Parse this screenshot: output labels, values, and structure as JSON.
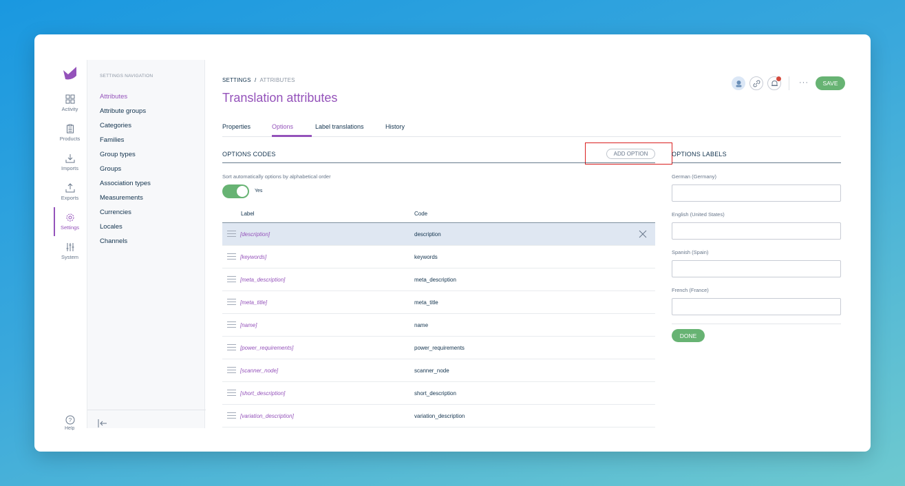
{
  "colors": {
    "accent": "#9452ba",
    "success": "#67b373",
    "text": "#11324d",
    "muted": "#67768a",
    "highlight": "#d91e1e"
  },
  "mainnav": {
    "items": [
      {
        "label": "Activity",
        "icon": "activity-icon"
      },
      {
        "label": "Products",
        "icon": "products-icon"
      },
      {
        "label": "Imports",
        "icon": "imports-icon"
      },
      {
        "label": "Exports",
        "icon": "exports-icon"
      },
      {
        "label": "Settings",
        "icon": "gear-icon",
        "active": true
      },
      {
        "label": "System",
        "icon": "sliders-icon"
      }
    ],
    "help_label": "Help"
  },
  "settings_nav": {
    "title": "SETTINGS NAVIGATION",
    "items": [
      "Attributes",
      "Attribute groups",
      "Categories",
      "Families",
      "Group types",
      "Groups",
      "Association types",
      "Measurements",
      "Currencies",
      "Locales",
      "Channels"
    ],
    "active": "Attributes"
  },
  "breadcrumb": {
    "root": "SETTINGS",
    "separator": "/",
    "current": "ATTRIBUTES"
  },
  "page_title": "Translation attributes",
  "header_actions": {
    "more_label": "···",
    "save_label": "SAVE"
  },
  "tabs": [
    "Properties",
    "Options",
    "Label translations",
    "History"
  ],
  "active_tab": "Options",
  "options_codes": {
    "title": "OPTIONS CODES",
    "add_button": "ADD OPTION",
    "sort_label": "Sort automatically options by alphabetical order",
    "sort_toggle": "Yes",
    "columns": {
      "label": "Label",
      "code": "Code"
    },
    "rows": [
      {
        "label": "[description]",
        "code": "description",
        "selected": true
      },
      {
        "label": "[keywords]",
        "code": "keywords"
      },
      {
        "label": "[meta_description]",
        "code": "meta_description"
      },
      {
        "label": "[meta_title]",
        "code": "meta_title"
      },
      {
        "label": "[name]",
        "code": "name"
      },
      {
        "label": "[power_requirements]",
        "code": "power_requirements"
      },
      {
        "label": "[scanner_node]",
        "code": "scanner_node"
      },
      {
        "label": "[short_description]",
        "code": "short_description"
      },
      {
        "label": "[variation_description]",
        "code": "variation_description"
      }
    ]
  },
  "options_labels": {
    "title": "OPTIONS LABELS",
    "locales": [
      {
        "label": "German (Germany)",
        "value": ""
      },
      {
        "label": "English (United States)",
        "value": ""
      },
      {
        "label": "Spanish (Spain)",
        "value": ""
      },
      {
        "label": "French (France)",
        "value": ""
      }
    ],
    "done_label": "DONE"
  }
}
